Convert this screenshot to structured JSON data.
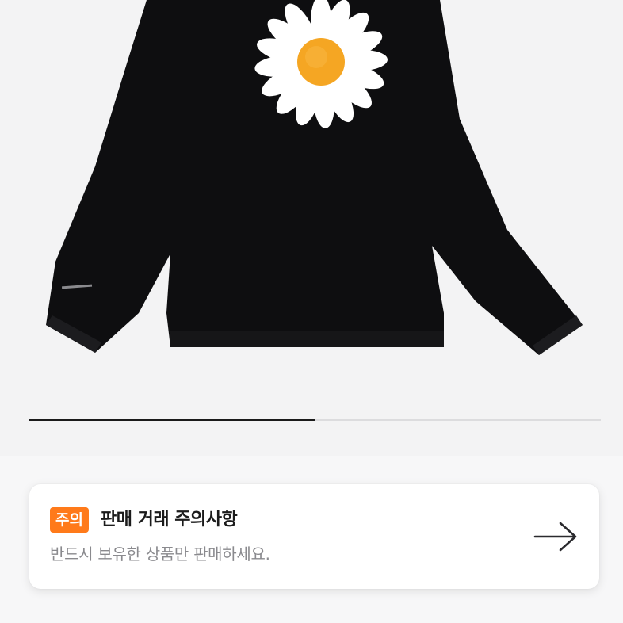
{
  "product_image": {
    "icon": "daisy-longsleeve-tshirt",
    "shirt_color": "#0e0e10",
    "petal_color": "#ffffff",
    "center_color": "#f5a623"
  },
  "carousel": {
    "progress_fraction": 0.5,
    "track_color": "#dcdcde",
    "fill_color": "#1a1a1a"
  },
  "notice": {
    "badge": "주의",
    "title": "판매 거래 주의사항",
    "description": "반드시 보유한 상품만 판매하세요.",
    "arrow_icon": "arrow-right-icon",
    "badge_color": "#ff7a1a"
  }
}
